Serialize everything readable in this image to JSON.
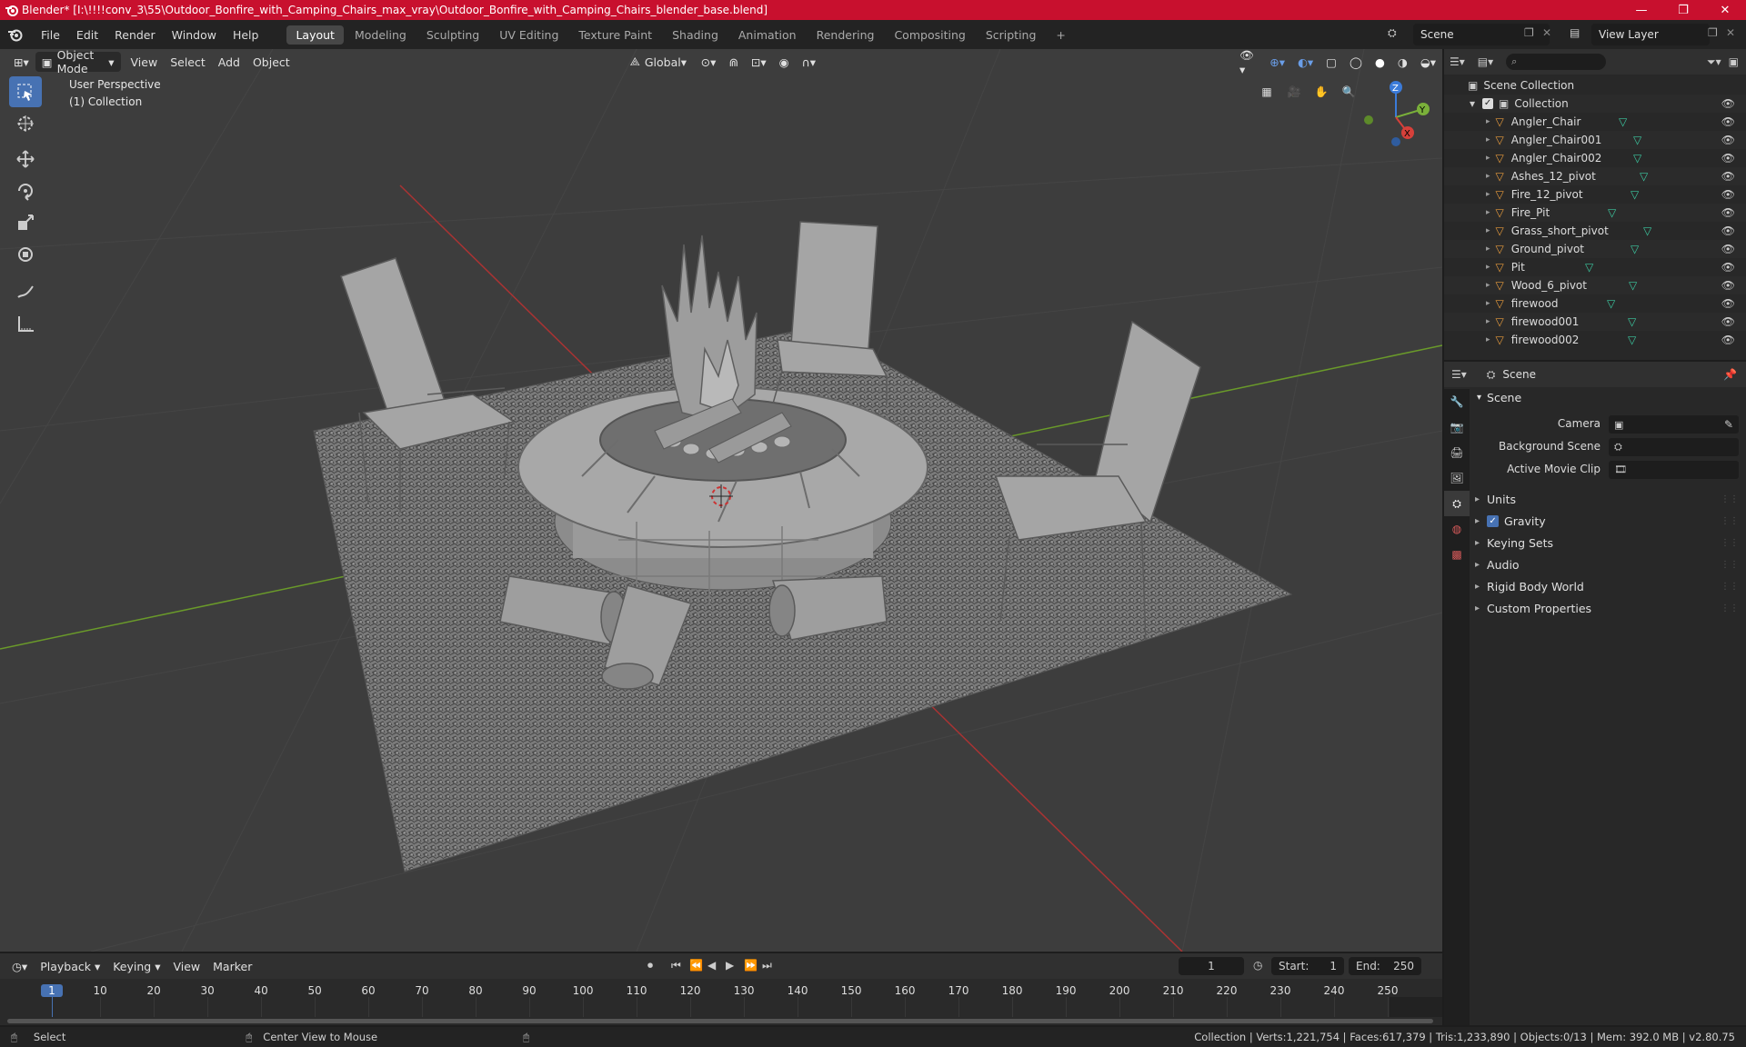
{
  "window": {
    "title": "Blender* [I:\\!!!!conv_3\\55\\Outdoor_Bonfire_with_Camping_Chairs_max_vray\\Outdoor_Bonfire_with_Camping_Chairs_blender_base.blend]",
    "minimize": "—",
    "maximize": "❐",
    "close": "✕"
  },
  "menu": [
    "File",
    "Edit",
    "Render",
    "Window",
    "Help"
  ],
  "workspaces": [
    "Layout",
    "Modeling",
    "Sculpting",
    "UV Editing",
    "Texture Paint",
    "Shading",
    "Animation",
    "Rendering",
    "Compositing",
    "Scripting"
  ],
  "active_workspace": "Layout",
  "add_workspace": "+",
  "scene_name": "Scene",
  "view_layer": "View Layer",
  "viewport": {
    "mode": "Object Mode",
    "menus": [
      "View",
      "Select",
      "Add",
      "Object"
    ],
    "orientation": "Global",
    "perspective": "User Perspective",
    "collection": "(1) Collection",
    "gizmo_axes": {
      "z": "Z",
      "y": "Y",
      "x": "X"
    }
  },
  "outliner": {
    "root": "Scene Collection",
    "collection": "Collection",
    "objects": [
      "Angler_Chair",
      "Angler_Chair001",
      "Angler_Chair002",
      "Ashes_12_pivot",
      "Fire_12_pivot",
      "Fire_Pit",
      "Grass_short_pivot",
      "Ground_pivot",
      "Pit",
      "Wood_6_pivot",
      "firewood",
      "firewood001",
      "firewood002"
    ]
  },
  "properties": {
    "context": "Scene",
    "panel": "Scene",
    "camera_label": "Camera",
    "background_scene_label": "Background Scene",
    "active_movie_clip_label": "Active Movie Clip",
    "subpanels": [
      "Units",
      "Gravity",
      "Keying Sets",
      "Audio",
      "Rigid Body World",
      "Custom Properties"
    ],
    "gravity_checked": true
  },
  "timeline": {
    "menus": [
      "Playback",
      "Keying",
      "View",
      "Marker"
    ],
    "current_frame": "1",
    "start_label": "Start:",
    "start": "1",
    "end_label": "End:",
    "end": "250",
    "ticks": [
      "1",
      "10",
      "20",
      "30",
      "40",
      "50",
      "60",
      "70",
      "80",
      "90",
      "100",
      "110",
      "120",
      "130",
      "140",
      "150",
      "160",
      "170",
      "180",
      "190",
      "200",
      "210",
      "220",
      "230",
      "240",
      "250"
    ]
  },
  "status": {
    "select": "Select",
    "center_view": "Center View to Mouse",
    "stats": "Collection | Verts:1,221,754 | Faces:617,379 | Tris:1,233,890 | Objects:0/13 | Mem: 392.0 MB | v2.80.75"
  },
  "colors": {
    "accent": "#4772b3",
    "title_bar": "#c8102e",
    "object_icon": "#e69a3c",
    "mesh_icon": "#3cc8a0"
  }
}
